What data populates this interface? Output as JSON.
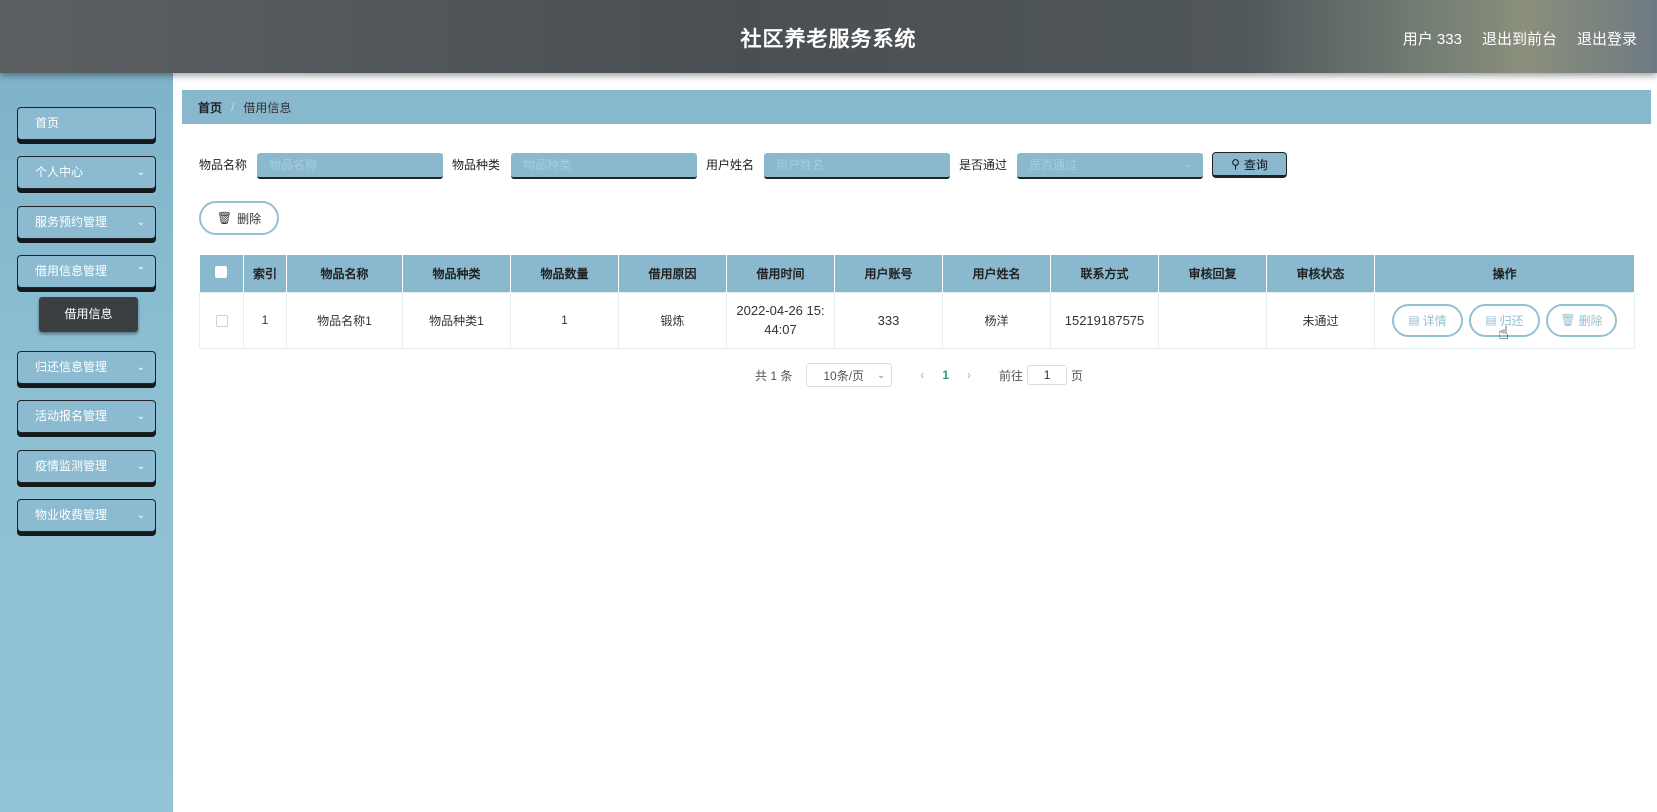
{
  "header": {
    "title": "社区养老服务系统",
    "user": "用户 333",
    "to_front": "退出到前台",
    "logout": "退出登录"
  },
  "sidebar": {
    "items": [
      {
        "label": "首页"
      },
      {
        "label": "个人中心"
      },
      {
        "label": "服务预约管理"
      },
      {
        "label": "借用信息管理"
      },
      {
        "label": "归还信息管理"
      },
      {
        "label": "活动报名管理"
      },
      {
        "label": "疫情监测管理"
      },
      {
        "label": "物业收费管理"
      }
    ],
    "submenu_active": "借用信息"
  },
  "breadcrumb": {
    "home": "首页",
    "sep": "/",
    "current": "借用信息"
  },
  "search": {
    "item_name_label": "物品名称",
    "item_name_placeholder": "物品名称",
    "item_type_label": "物品种类",
    "item_type_placeholder": "物品种类",
    "user_name_label": "用户姓名",
    "user_name_placeholder": "用户姓名",
    "approved_label": "是否通过",
    "approved_placeholder": "是否通过",
    "query_label": "查询"
  },
  "actions": {
    "delete_label": "删除"
  },
  "table": {
    "headers": [
      "索引",
      "物品名称",
      "物品种类",
      "物品数量",
      "借用原因",
      "借用时间",
      "用户账号",
      "用户姓名",
      "联系方式",
      "审核回复",
      "审核状态",
      "操作"
    ],
    "rows": [
      {
        "index": "1",
        "item_name": "物品名称1",
        "item_type": "物品种类1",
        "quantity": "1",
        "reason": "锻炼",
        "borrow_time_1": "2022-04-26 15:",
        "borrow_time_2": "44:07",
        "account": "333",
        "user_name": "杨洋",
        "contact": "15219187575",
        "review_reply": "",
        "review_status": "未通过",
        "ops": {
          "detail": "详情",
          "return": "归还",
          "delete": "删除"
        }
      }
    ]
  },
  "pagination": {
    "total": "共 1 条",
    "page_size": "10条/页",
    "current_page": "1",
    "goto_label": "前往",
    "goto_value": "1",
    "page_suffix": "页"
  },
  "colors": {
    "header_bg": "#4f5458",
    "sidebar_bg": "#8dbfd3",
    "accent": "#8ab9cf",
    "outline": "#94c0d4",
    "page_active": "#2a9d6e"
  }
}
